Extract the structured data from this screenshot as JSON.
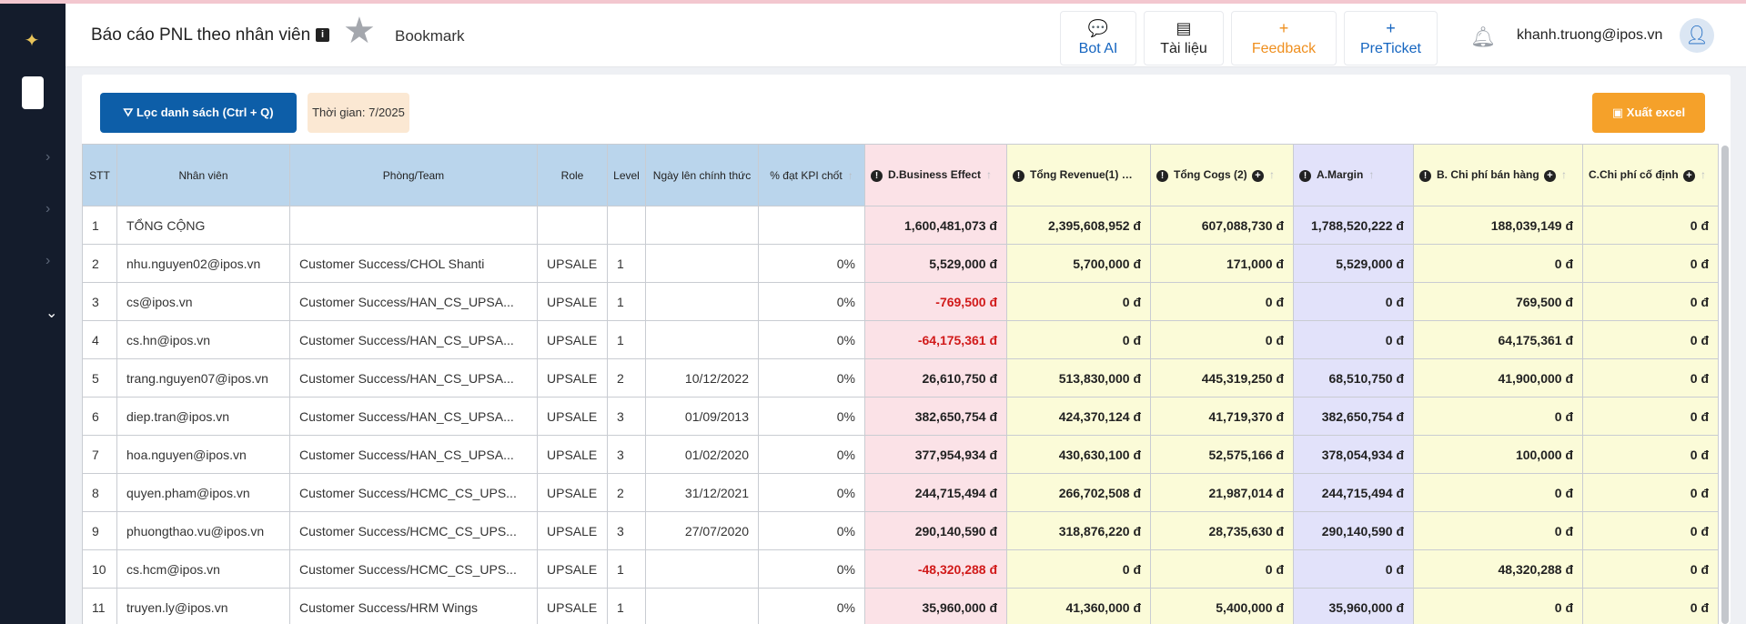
{
  "header": {
    "title": "Báo cáo PNL theo nhân viên",
    "bookmark_label": "Bookmark",
    "buttons": {
      "bot_ai": "Bot AI",
      "tai_lieu": "Tài liệu",
      "feedback": "Feedback",
      "preticket": "PreTicket"
    },
    "user_email": "khanh.truong@ipos.vn"
  },
  "toolbar": {
    "filter_label": "Lọc danh sách (Ctrl + Q)",
    "time_label": "Thời gian: 7/2025",
    "export_label": "Xuất excel"
  },
  "colors": {
    "primary": "#0d5ea8",
    "export": "#f5a12a",
    "negative": "#d11a1a",
    "header_blue": "#bad5ec",
    "header_pink": "#fbe2e7",
    "header_yellow": "#fbfbd8",
    "header_lavender": "#e2e2fa"
  },
  "table": {
    "columns": {
      "stt": "STT",
      "nhan_vien": "Nhân viên",
      "phong_team": "Phòng/Team",
      "role": "Role",
      "level": "Level",
      "ngay": "Ngày lên chính thức",
      "kpi": "% đạt KPI chốt",
      "business_effect": "D.Business Effect",
      "revenue": "Tổng Revenue(1)",
      "cogs": "Tổng Cogs (2)",
      "margin": "A.Margin",
      "chi_phi_ban_hang": "B. Chi phí bán hàng",
      "chi_phi_co_dinh": "C.Chi phí cố định"
    },
    "rows": [
      {
        "stt": "1",
        "name": "TỔNG CỘNG",
        "team": "",
        "role": "",
        "level": "",
        "date": "",
        "kpi": "",
        "effect": "1,600,481,073 đ",
        "revenue": "2,395,608,952 đ",
        "cogs": "607,088,730 đ",
        "margin": "1,788,520,222 đ",
        "sales_cost": "188,039,149 đ",
        "fixed_cost": "0 đ",
        "neg": false
      },
      {
        "stt": "2",
        "name": "nhu.nguyen02@ipos.vn",
        "team": "Customer Success/CHOL Shanti",
        "role": "UPSALE",
        "level": "1",
        "date": "",
        "kpi": "0%",
        "effect": "5,529,000 đ",
        "revenue": "5,700,000 đ",
        "cogs": "171,000 đ",
        "margin": "5,529,000 đ",
        "sales_cost": "0 đ",
        "fixed_cost": "0 đ",
        "neg": false
      },
      {
        "stt": "3",
        "name": "cs@ipos.vn",
        "team": "Customer Success/HAN_CS_UPSA...",
        "role": "UPSALE",
        "level": "1",
        "date": "",
        "kpi": "0%",
        "effect": "-769,500 đ",
        "revenue": "0 đ",
        "cogs": "0 đ",
        "margin": "0 đ",
        "sales_cost": "769,500 đ",
        "fixed_cost": "0 đ",
        "neg": true
      },
      {
        "stt": "4",
        "name": "cs.hn@ipos.vn",
        "team": "Customer Success/HAN_CS_UPSA...",
        "role": "UPSALE",
        "level": "1",
        "date": "",
        "kpi": "0%",
        "effect": "-64,175,361 đ",
        "revenue": "0 đ",
        "cogs": "0 đ",
        "margin": "0 đ",
        "sales_cost": "64,175,361 đ",
        "fixed_cost": "0 đ",
        "neg": true
      },
      {
        "stt": "5",
        "name": "trang.nguyen07@ipos.vn",
        "team": "Customer Success/HAN_CS_UPSA...",
        "role": "UPSALE",
        "level": "2",
        "date": "10/12/2022",
        "kpi": "0%",
        "effect": "26,610,750 đ",
        "revenue": "513,830,000 đ",
        "cogs": "445,319,250 đ",
        "margin": "68,510,750 đ",
        "sales_cost": "41,900,000 đ",
        "fixed_cost": "0 đ",
        "neg": false
      },
      {
        "stt": "6",
        "name": "diep.tran@ipos.vn",
        "team": "Customer Success/HAN_CS_UPSA...",
        "role": "UPSALE",
        "level": "3",
        "date": "01/09/2013",
        "kpi": "0%",
        "effect": "382,650,754 đ",
        "revenue": "424,370,124 đ",
        "cogs": "41,719,370 đ",
        "margin": "382,650,754 đ",
        "sales_cost": "0 đ",
        "fixed_cost": "0 đ",
        "neg": false
      },
      {
        "stt": "7",
        "name": "hoa.nguyen@ipos.vn",
        "team": "Customer Success/HAN_CS_UPSA...",
        "role": "UPSALE",
        "level": "3",
        "date": "01/02/2020",
        "kpi": "0%",
        "effect": "377,954,934 đ",
        "revenue": "430,630,100 đ",
        "cogs": "52,575,166 đ",
        "margin": "378,054,934 đ",
        "sales_cost": "100,000 đ",
        "fixed_cost": "0 đ",
        "neg": false
      },
      {
        "stt": "8",
        "name": "quyen.pham@ipos.vn",
        "team": "Customer Success/HCMC_CS_UPS...",
        "role": "UPSALE",
        "level": "2",
        "date": "31/12/2021",
        "kpi": "0%",
        "effect": "244,715,494 đ",
        "revenue": "266,702,508 đ",
        "cogs": "21,987,014 đ",
        "margin": "244,715,494 đ",
        "sales_cost": "0 đ",
        "fixed_cost": "0 đ",
        "neg": false
      },
      {
        "stt": "9",
        "name": "phuongthao.vu@ipos.vn",
        "team": "Customer Success/HCMC_CS_UPS...",
        "role": "UPSALE",
        "level": "3",
        "date": "27/07/2020",
        "kpi": "0%",
        "effect": "290,140,590 đ",
        "revenue": "318,876,220 đ",
        "cogs": "28,735,630 đ",
        "margin": "290,140,590 đ",
        "sales_cost": "0 đ",
        "fixed_cost": "0 đ",
        "neg": false
      },
      {
        "stt": "10",
        "name": "cs.hcm@ipos.vn",
        "team": "Customer Success/HCMC_CS_UPS...",
        "role": "UPSALE",
        "level": "1",
        "date": "",
        "kpi": "0%",
        "effect": "-48,320,288 đ",
        "revenue": "0 đ",
        "cogs": "0 đ",
        "margin": "0 đ",
        "sales_cost": "48,320,288 đ",
        "fixed_cost": "0 đ",
        "neg": true
      },
      {
        "stt": "11",
        "name": "truyen.ly@ipos.vn",
        "team": "Customer Success/HRM Wings",
        "role": "UPSALE",
        "level": "1",
        "date": "",
        "kpi": "0%",
        "effect": "35,960,000 đ",
        "revenue": "41,360,000 đ",
        "cogs": "5,400,000 đ",
        "margin": "35,960,000 đ",
        "sales_cost": "0 đ",
        "fixed_cost": "0 đ",
        "neg": false
      }
    ]
  }
}
